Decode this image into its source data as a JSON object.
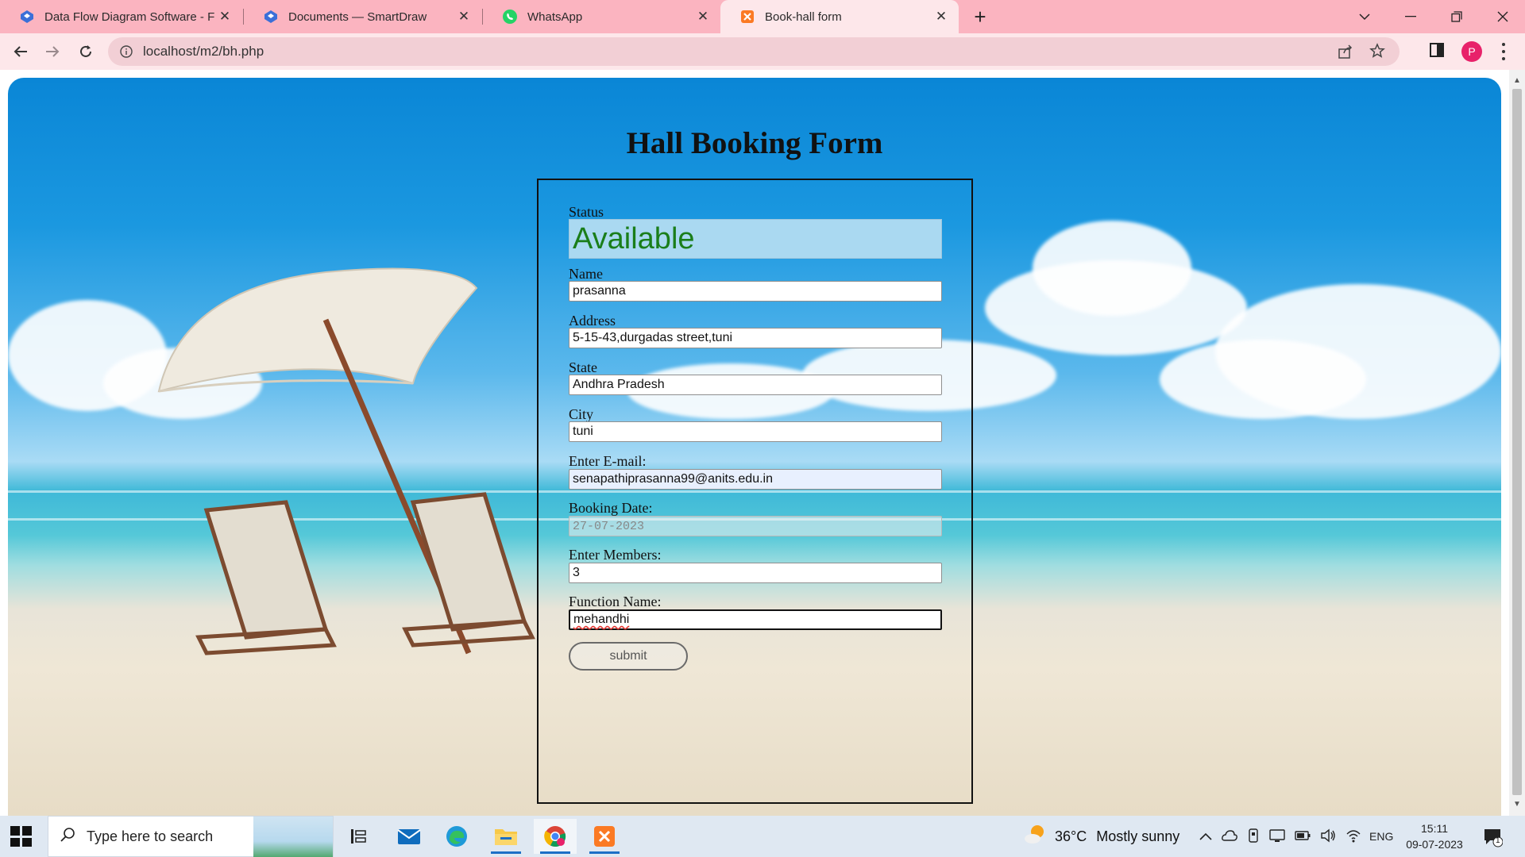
{
  "browser": {
    "tabs": [
      {
        "title": "Data Flow Diagram Software - Fr",
        "icon": "smartdraw-icon"
      },
      {
        "title": "Documents — SmartDraw",
        "icon": "smartdraw-icon"
      },
      {
        "title": "WhatsApp",
        "icon": "whatsapp-icon"
      },
      {
        "title": "Book-hall form",
        "icon": "xampp-icon",
        "active": true
      }
    ],
    "url": "localhost/m2/bh.php",
    "profile_initial": "P",
    "accent": "#fbb4c0"
  },
  "page": {
    "title": "Hall Booking Form",
    "status": {
      "label": "Status",
      "value": "Available",
      "color": "#1a7e1a"
    },
    "fields": [
      {
        "label": "Name",
        "value": "prasanna"
      },
      {
        "label": "Address",
        "value": "5-15-43,durgadas street,tuni"
      },
      {
        "label": "State",
        "value": "Andhra Pradesh"
      },
      {
        "label": "City",
        "value": "tuni"
      },
      {
        "label": "Enter E-mail:",
        "value": "senapathiprasanna99@anits.edu.in"
      },
      {
        "label": "Booking Date:",
        "value": "27-07-2023"
      },
      {
        "label": "Enter Members:",
        "value": "3"
      },
      {
        "label": "Function Name:",
        "value": "mehandhi"
      }
    ],
    "submit_label": "submit"
  },
  "taskbar": {
    "search_placeholder": "Type here to search",
    "weather_temp": "36°C",
    "weather_condition": "Mostly sunny",
    "language": "ENG",
    "time": "15:11",
    "date": "09-07-2023",
    "notification_count": "1"
  }
}
